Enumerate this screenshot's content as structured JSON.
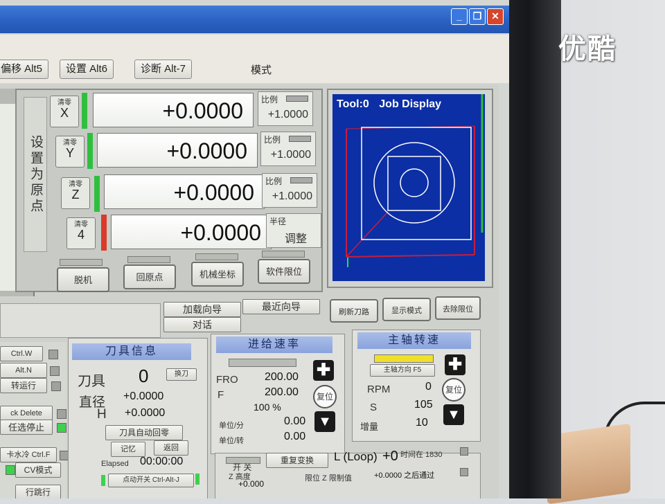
{
  "tabs": {
    "offset": "偏移 Alt5",
    "settings": "设置 Alt6",
    "diagnose": "诊断 Alt-7",
    "mode": "模式"
  },
  "dro": {
    "set_home_label": "设置为原点",
    "zero_label": "清零",
    "axes": [
      {
        "axis": "X",
        "value": "+0.0000",
        "ratio_label": "比例",
        "ratio_value": "+1.0000",
        "led_color": "#2fbf3f"
      },
      {
        "axis": "Y",
        "value": "+0.0000",
        "ratio_label": "比例",
        "ratio_value": "+1.0000",
        "led_color": "#2fbf3f"
      },
      {
        "axis": "Z",
        "value": "+0.0000",
        "ratio_label": "比例",
        "ratio_value": "+1.0000",
        "led_color": "#2fbf3f"
      },
      {
        "axis": "4",
        "value": "+0.0000",
        "ratio_label": "半径",
        "ratio_value": "调整",
        "led_color": "#d93a2a"
      }
    ],
    "buttons": [
      "脱机",
      "回原点",
      "机械坐标",
      "软件限位"
    ]
  },
  "job_display": {
    "tool": "Tool:0",
    "title": "Job Display"
  },
  "wizards": {
    "load_wizard": "加载向导",
    "recent_wizard": "最近向导",
    "dialog": "对话"
  },
  "view_buttons": [
    "刷新刀路",
    "显示模式",
    "去除限位"
  ],
  "left_list": [
    {
      "label": "Ctrl.W",
      "led": false
    },
    {
      "label": "Alt.N",
      "led": false
    },
    {
      "label": "转运行",
      "led": false
    },
    {
      "label": "ck Delete",
      "led": false
    },
    {
      "label": "任选停止",
      "led": true
    },
    {
      "label": "卡水冷 Ctrl.F",
      "led": false
    },
    {
      "label": "CV模式",
      "led": true
    },
    {
      "label": "行跳行",
      "led": false
    }
  ],
  "tool_info": {
    "header": "刀具信息",
    "tool_label": "刀具",
    "tool_value": "0",
    "tool_btn": "换刀",
    "dia_label": "直径",
    "dia_value": "+0.0000",
    "h_label": "H",
    "h_value": "+0.0000",
    "auto_change": "刀具自动回零",
    "remember": "记忆",
    "return": "返回",
    "elapsed_label": "Elapsed",
    "elapsed_value": "00:00:00",
    "jog_toggle": "点动开关 Ctrl-Alt-J"
  },
  "feed_rate": {
    "header": "进给速率",
    "fro_label": "FRO",
    "fro_value": "200.00",
    "f_label": "F",
    "f_value": "200.00",
    "percent": "100 %",
    "units_min_label": "单位/分",
    "units_min_value": "0.00",
    "units_rev_label": "单位/转",
    "units_rev_value": "0.00",
    "reset": "复位"
  },
  "spindle": {
    "header": "主轴转速",
    "direction_btn": "主轴方向 F5",
    "rpm_label": "RPM",
    "rpm_value": "0",
    "s_label": "S",
    "s_value": "105",
    "step_label": "增量",
    "step_value": "10",
    "reset": "复位"
  },
  "bottom": {
    "repeat_btn": "重复变换",
    "loop_label": "L (Loop)",
    "loop_value": "+0",
    "loop_note": "时间在 1830",
    "open_label": "开  关",
    "z_height_label": "Z 高度",
    "z_height_value": "+0.000",
    "z_inhibit_label": "限位 Z 限制值",
    "z_inhibit_value": "+0.0000 之后通过"
  },
  "watermark": "优酷"
}
